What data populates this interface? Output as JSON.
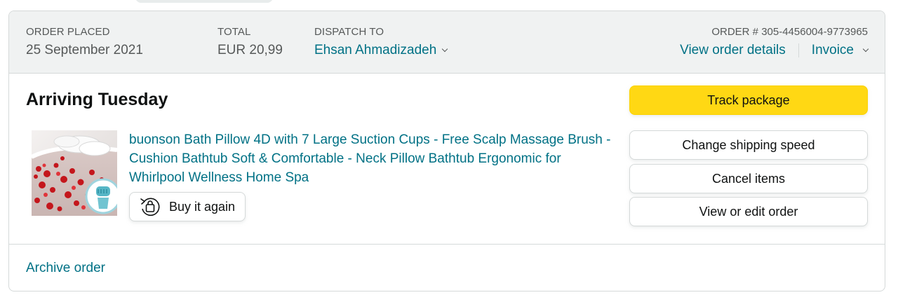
{
  "header": {
    "order_placed_label": "ORDER PLACED",
    "order_placed_value": "25 September 2021",
    "total_label": "TOTAL",
    "total_value": "EUR 20,99",
    "dispatch_label": "DISPATCH TO",
    "dispatch_value": "Ehsan Ahmadizadeh",
    "order_number": "ORDER # 305-4456004-9773965",
    "view_details": "View order details",
    "invoice": "Invoice"
  },
  "shipment": {
    "status": "Arriving Tuesday"
  },
  "product": {
    "title": "buonson Bath Pillow 4D with 7 Large Suction Cups - Free Scalp Massage Brush - Cushion Bathtub Soft & Comfortable - Neck Pillow Bathtub Ergonomic for Whirlpool Wellness Home Spa",
    "buy_again": "Buy it again"
  },
  "actions": {
    "track": "Track package",
    "change_speed": "Change shipping speed",
    "cancel": "Cancel items",
    "view_edit": "View or edit order"
  },
  "footer": {
    "archive": "Archive order"
  },
  "colors": {
    "link": "#007185",
    "primary_button": "#ffd814",
    "header_bg": "#f0f2f2",
    "border": "#d5d9d9"
  },
  "icons": {
    "buy_again": "buy-again-icon",
    "dropdown": "chevron-down-icon"
  }
}
